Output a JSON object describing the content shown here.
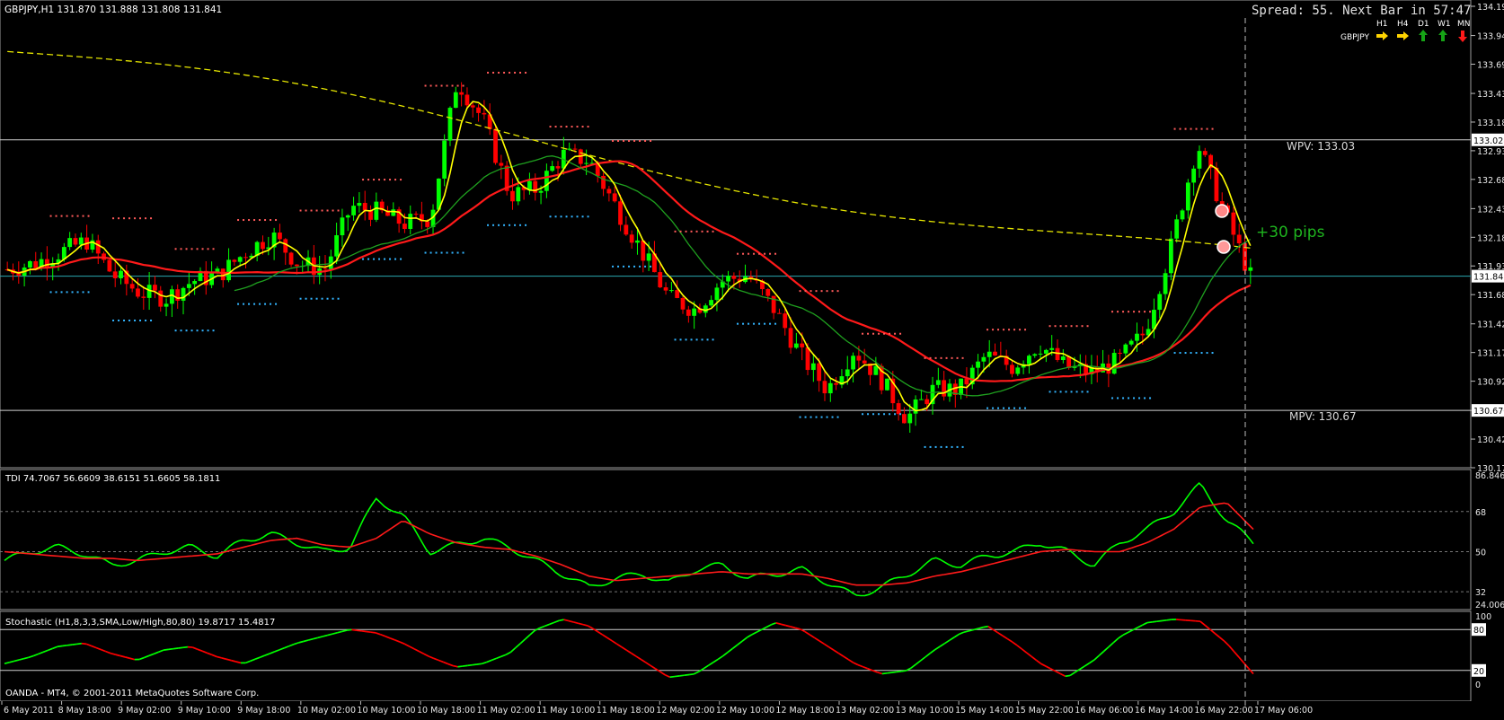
{
  "main": {
    "header": "GBPJPY,H1  131.870 131.888 131.808 131.841",
    "spread_text": "Spread: 55. Next Bar in 57:47",
    "tf_labels": [
      "H1",
      "H4",
      "D1",
      "W1",
      "MN"
    ],
    "symbol": "GBPJPY",
    "tf_arrows": [
      {
        "dir": "right",
        "color": "#ffd400"
      },
      {
        "dir": "right",
        "color": "#ffd400"
      },
      {
        "dir": "up",
        "color": "#16a316"
      },
      {
        "dir": "up",
        "color": "#16a316"
      },
      {
        "dir": "down",
        "color": "#ff1a1a"
      }
    ],
    "price_ticks": [
      "134.195",
      "133.940",
      "133.690",
      "133.435",
      "133.185",
      "132.935",
      "132.685",
      "132.430",
      "132.180",
      "131.930",
      "131.680",
      "131.425",
      "131.175",
      "130.925",
      "130.670",
      "130.420",
      "130.170"
    ],
    "current_price": "131.841",
    "wpv_box": "133.028",
    "mpv_box": "130.670",
    "wpv_label": "WPV:  133.03",
    "mpv_label": "MPV:  130.67",
    "pips_label": "+30 pips"
  },
  "tdi": {
    "header": "TDI 74.7067 56.6609 38.6151 51.6605 58.1811",
    "ticks": [
      "86.8461",
      "68",
      "50",
      "32",
      "24.006"
    ]
  },
  "stoch": {
    "header": "Stochastic (H1,8,3,3,SMA,Low/High,80,80) 19.8717 15.4817",
    "ticks": [
      "100",
      "80",
      "20",
      "0"
    ]
  },
  "footer": {
    "copyright": "OANDA - MT4, © 2001-2011 MetaQuotes Software Corp."
  },
  "colors": {
    "bull": "#00ff00",
    "bear": "#ff0000",
    "ma_fast": "#ffff00",
    "ma_slow": "#ff1a1a",
    "ma_green": "#1fa01f",
    "ma_dashed": "#e6e600",
    "dots_red": "#ff5a5a",
    "dots_blue": "#33b5ff",
    "grid": "#cfcfcf",
    "price_line": "#2aa7b0"
  },
  "chart_data": [
    {
      "type": "candlestick",
      "title": "GBPJPY,H1",
      "x_labels": [
        "6 May 2011",
        "8 May 18:00",
        "9 May 02:00",
        "9 May 10:00",
        "9 May 18:00",
        "10 May 02:00",
        "10 May 10:00",
        "10 May 18:00",
        "11 May 02:00",
        "11 May 10:00",
        "11 May 18:00",
        "12 May 02:00",
        "12 May 10:00",
        "12 May 18:00",
        "13 May 02:00",
        "13 May 10:00",
        "15 May 14:00",
        "15 May 22:00",
        "16 May 06:00",
        "16 May 14:00",
        "16 May 22:00",
        "17 May 06:00"
      ],
      "ylim": [
        130.17,
        134.195
      ],
      "close_path": [
        131.9,
        131.95,
        132.05,
        132.15,
        131.85,
        131.7,
        131.65,
        131.8,
        131.85,
        132.05,
        132.2,
        131.95,
        131.9,
        132.45,
        132.4,
        132.3,
        132.35,
        133.55,
        133.2,
        132.55,
        132.6,
        132.9,
        132.85,
        132.45,
        132.05,
        131.65,
        131.55,
        131.8,
        131.85,
        131.55,
        131.15,
        130.85,
        131.2,
        130.95,
        130.6,
        130.85,
        130.85,
        131.15,
        131.05,
        131.25,
        131.05,
        131.0,
        131.1,
        131.35,
        132.1,
        133.0,
        132.4,
        131.84
      ],
      "levels": {
        "WPV": 133.03,
        "MPV": 130.67,
        "current": 131.841
      },
      "annotation": "+30 pips"
    },
    {
      "type": "line",
      "title": "TDI",
      "ylim": [
        24.006,
        86.8461
      ],
      "levels": [
        68,
        50,
        32
      ],
      "series": [
        {
          "name": "green",
          "color": "#00ff00",
          "values": [
            46,
            50,
            52,
            49,
            44,
            46,
            50,
            52,
            48,
            55,
            58,
            54,
            50,
            52,
            74,
            66,
            50,
            53,
            56,
            52,
            46,
            40,
            34,
            38,
            40,
            36,
            42,
            44,
            38,
            40,
            42,
            36,
            30,
            34,
            40,
            46,
            44,
            48,
            50,
            54,
            50,
            44,
            54,
            60,
            68,
            80,
            64,
            54
          ]
        },
        {
          "name": "red",
          "color": "#ff1a1a",
          "values": [
            50,
            49,
            48,
            47,
            47,
            46,
            47,
            48,
            49,
            52,
            55,
            56,
            53,
            52,
            56,
            64,
            58,
            54,
            52,
            51,
            48,
            44,
            39,
            37,
            38,
            39,
            40,
            41,
            40,
            40,
            40,
            38,
            35,
            35,
            36,
            39,
            41,
            44,
            47,
            50,
            51,
            50,
            50,
            54,
            60,
            70,
            72,
            60
          ]
        }
      ]
    },
    {
      "type": "line",
      "title": "Stochastic (H1,8,3,3,SMA,Low/High,80,80)",
      "ylim": [
        0,
        100
      ],
      "levels": [
        80,
        20
      ],
      "series": [
        {
          "name": "main",
          "values": [
            30,
            40,
            55,
            60,
            45,
            35,
            50,
            55,
            40,
            30,
            45,
            60,
            70,
            80,
            75,
            60,
            40,
            25,
            30,
            45,
            80,
            95,
            85,
            60,
            35,
            10,
            15,
            40,
            70,
            90,
            80,
            55,
            30,
            15,
            20,
            50,
            75,
            85,
            60,
            30,
            10,
            35,
            70,
            90,
            95,
            92,
            60,
            15
          ]
        }
      ]
    }
  ]
}
